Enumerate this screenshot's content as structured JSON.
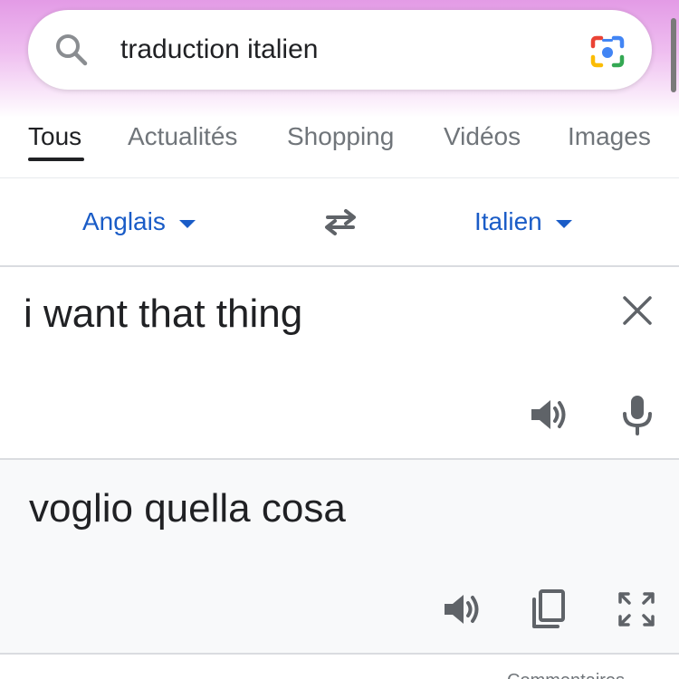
{
  "search": {
    "query": "traduction italien",
    "icon": "search-icon",
    "lens_icon": "google-lens-camera-icon"
  },
  "tabs": [
    {
      "label": "Tous",
      "active": true
    },
    {
      "label": "Actualités",
      "active": false
    },
    {
      "label": "Shopping",
      "active": false
    },
    {
      "label": "Vidéos",
      "active": false
    },
    {
      "label": "Images",
      "active": false
    }
  ],
  "translator": {
    "source_language": "Anglais",
    "target_language": "Italien",
    "swap_icon": "swap-arrows-icon",
    "source_text": "i want that thing",
    "translated_text": "voglio quella cosa",
    "source_actions": [
      "clear-icon",
      "speaker-icon",
      "microphone-icon"
    ],
    "target_actions": [
      "speaker-icon",
      "copy-icon",
      "fullscreen-icon"
    ]
  },
  "footer": {
    "partial_text": "Commentaires"
  },
  "colors": {
    "accent_link": "#1a5cc7",
    "text_primary": "#202124",
    "text_secondary": "#70757a",
    "icon_gray": "#5f6368",
    "header_gradient_top": "#e39be6",
    "target_panel_bg": "#f8f9fa"
  }
}
